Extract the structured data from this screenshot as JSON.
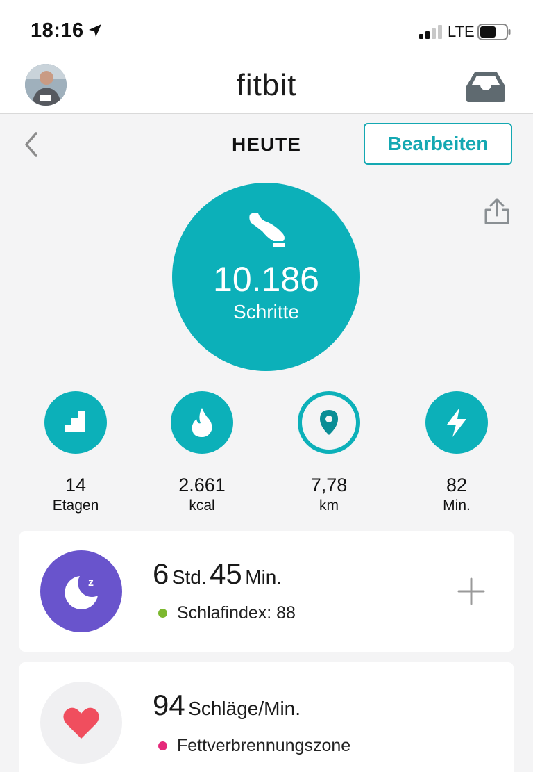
{
  "status_bar": {
    "time": "18:16",
    "network": "LTE",
    "icons": [
      "location-arrow-icon",
      "signal-icon",
      "battery-icon"
    ]
  },
  "header": {
    "logo": "fitbit",
    "icons": [
      "avatar",
      "inbox-icon"
    ]
  },
  "date_bar": {
    "title": "HEUTE",
    "edit_label": "Bearbeiten",
    "icons": [
      "back-chevron-icon",
      "share-icon"
    ]
  },
  "steps": {
    "value": "10.186",
    "label": "Schritte",
    "icon": "shoe-icon"
  },
  "stats": [
    {
      "value": "14",
      "label": "Etagen",
      "icon": "stairs-icon"
    },
    {
      "value": "2.661",
      "label": "kcal",
      "icon": "flame-icon"
    },
    {
      "value": "7,78",
      "label": "km",
      "icon": "location-pin-icon"
    },
    {
      "value": "82",
      "label": "Min.",
      "icon": "lightning-icon"
    }
  ],
  "sleep": {
    "hours": "6",
    "hours_unit": "Std.",
    "minutes": "45",
    "minutes_unit": "Min.",
    "score_text": "Schlafindex: 88",
    "score_color": "#7cb82f",
    "icon": "moon-icon"
  },
  "heart": {
    "bpm": "94",
    "unit": "Schläge/Min.",
    "zone_text": "Fettverbrennungszone",
    "zone_color": "#e5297a",
    "icon": "heart-icon"
  },
  "colors": {
    "teal": "#0cb0b9",
    "purple": "#6954cc",
    "heart_red": "#f04e5e"
  }
}
